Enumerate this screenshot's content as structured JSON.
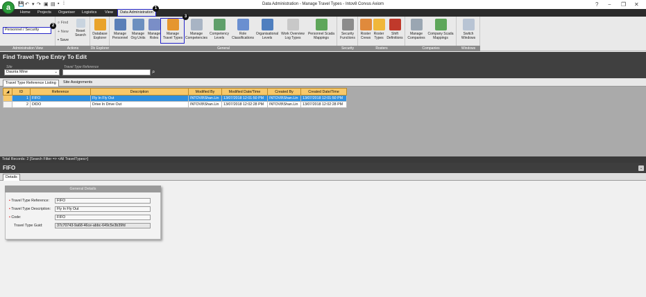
{
  "app": {
    "logo": "a",
    "title": "Data Administration - Manage Travel Types - Intov8 Corvus Axiom"
  },
  "window_controls": {
    "minimize": "−",
    "restore": "❐",
    "close": "✕"
  },
  "menu": {
    "items": [
      "Home",
      "Projects",
      "Organiser",
      "Logistics",
      "View"
    ],
    "active": "Data Administration",
    "style": "Style"
  },
  "badges": [
    "1",
    "2",
    "3"
  ],
  "ribbon": {
    "admin_view_value": "Personnel / Security",
    "admin_view_label": "Administration View",
    "actions": {
      "find": "Find",
      "new": "New",
      "save": "Save",
      "reset": "Reset Search",
      "label": "Actions"
    },
    "db_explorer": {
      "button": "Database Explorer",
      "label": "Db Explorer"
    },
    "general": {
      "label": "General",
      "buttons": [
        "Manage Personnel",
        "Manage Org Units",
        "Manage Roles",
        "Manage Travel Types",
        "Manage Competencies",
        "Competency Levels",
        "Role Classifications",
        "Organisational Levels",
        "Work Overview Log Types",
        "Personnel Scada Mappings"
      ]
    },
    "security": {
      "label": "Security",
      "buttons": [
        "Security Functions"
      ]
    },
    "rosters": {
      "label": "Rosters",
      "buttons": [
        "Roster Crews",
        "Roster Types",
        "Shift Definitions"
      ]
    },
    "companies": {
      "label": "Companies",
      "buttons": [
        "Manage Companies",
        "Company Scada Mappings"
      ]
    },
    "windows": {
      "label": "Windows",
      "buttons": [
        "Switch Windows"
      ]
    }
  },
  "find": {
    "title": "Find Travel Type Entry To Edit",
    "site_label": "Site",
    "site_value": "Daunia Mine",
    "ref_label": "Travel Type Reference",
    "ref_value": ""
  },
  "tabs": [
    "Travel Type Reference Listing",
    "Site Assignments"
  ],
  "grid": {
    "columns": [
      "ID",
      "Reference",
      "Description",
      "Modified By",
      "Modified Date/Time",
      "Created By",
      "Created Date/Time"
    ],
    "rows": [
      [
        "1",
        "FIFO",
        "Fly In Fly Out",
        "INTOV8\\Shan.Lin",
        "13/07/2018 12:01:50 PM",
        "INTOV8\\Shan.Lin",
        "13/07/2018 12:01:50 PM"
      ],
      [
        "2",
        "DIDO",
        "Drive In Drive Out",
        "INTOV8\\Shan.Lin",
        "13/07/2018 12:02:28 PM",
        "INTOV8\\Shan.Lin",
        "13/07/2018 12:02:28 PM"
      ]
    ],
    "selected_row": 0
  },
  "totals": "Total Records: 2 [Search Filter => <All TravelTypes>]",
  "detail": {
    "title": "FIFO",
    "tab": "Details",
    "panel_title": "General Details",
    "fields": [
      {
        "label": "Travel Type Reference:",
        "value": "FIFO",
        "required": true
      },
      {
        "label": "Travel Type Description:",
        "value": "Fly In Fly Out",
        "required": true
      },
      {
        "label": "Code:",
        "value": "FIFO",
        "required": true
      },
      {
        "label": "Travel Type Guid:",
        "value": "37c70743-9a68-46ce-abbc-649c5e3b39fd",
        "required": false
      }
    ]
  },
  "colors": {
    "accent_highlight": "#2323c8",
    "grid_header": "#f7c86a",
    "selection": "#2f8fde",
    "menubar": "#2b2b2b"
  }
}
